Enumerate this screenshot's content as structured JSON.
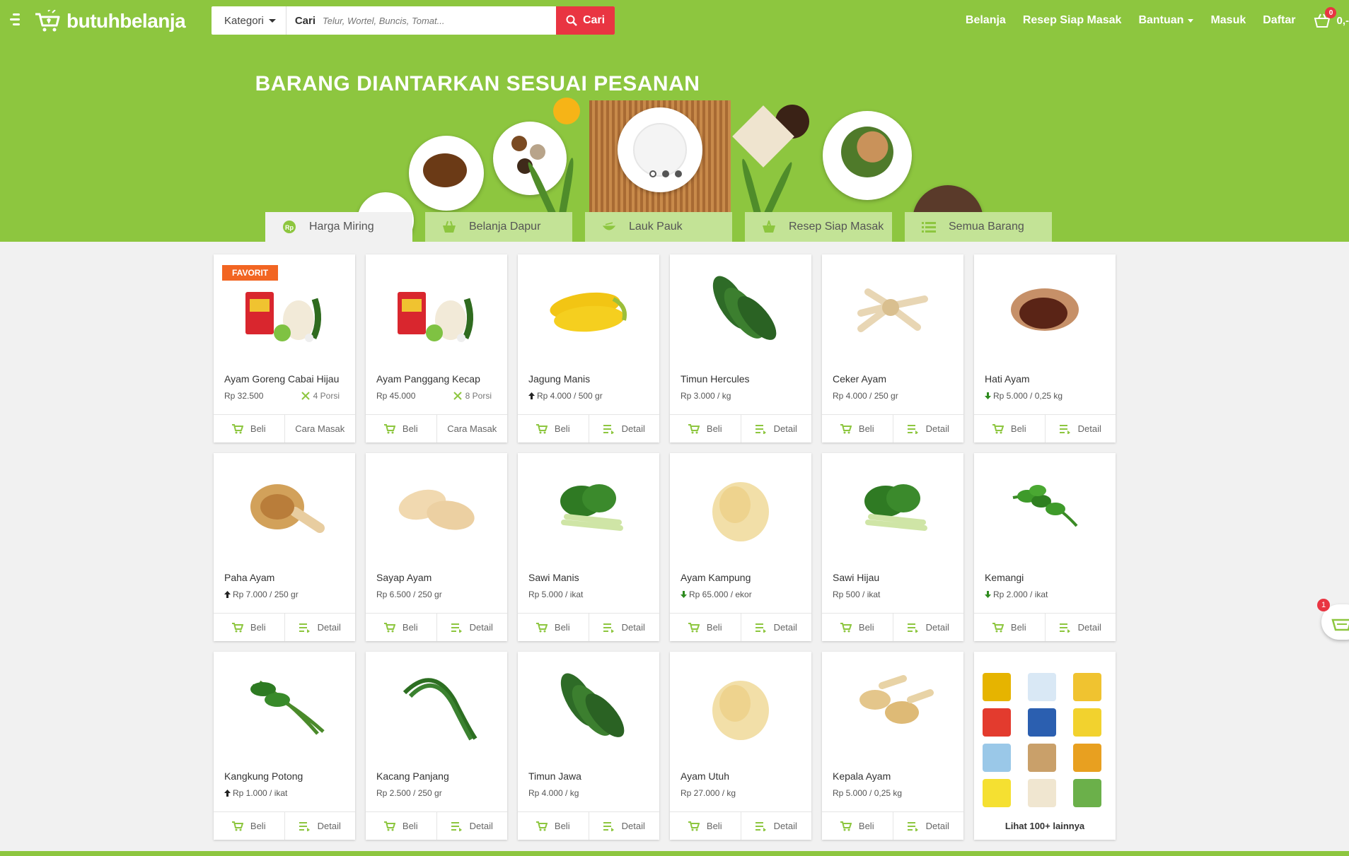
{
  "brand": {
    "name": "butuhbelanja",
    "accent": "#8dc63f",
    "search_red": "#e93542"
  },
  "search": {
    "category_label": "Kategori",
    "label": "Cari",
    "placeholder": "Telur, Wortel, Buncis, Tomat...",
    "button": "Cari"
  },
  "nav": {
    "items": [
      "Belanja",
      "Resep Siap Masak",
      "Bantuan",
      "Masuk",
      "Daftar"
    ],
    "cart_count": "0",
    "cart_total": "0,-"
  },
  "hero": {
    "title": "BARANG DIANTARKAN SESUAI PESANAN",
    "slides": 3,
    "active_slide": 2
  },
  "tabs": [
    {
      "label": "Harga Miring",
      "icon": "rp-coin-icon",
      "active": true
    },
    {
      "label": "Belanja Dapur",
      "icon": "basket-icon",
      "active": false
    },
    {
      "label": "Lauk Pauk",
      "icon": "bowl-icon",
      "active": false
    },
    {
      "label": "Resep Siap Masak",
      "icon": "recipe-basket-icon",
      "active": false
    },
    {
      "label": "Semua Barang",
      "icon": "list-icon",
      "active": false
    }
  ],
  "products": [
    {
      "name": "Ayam Goreng Cabai Hijau",
      "price": "Rp 32.500",
      "portion": "4 Porsi",
      "trend": "none",
      "badge": "FAVORIT",
      "action_left": "Beli",
      "action_right": "Cara Masak",
      "image": "recipe-bundle"
    },
    {
      "name": "Ayam Panggang Kecap",
      "price": "Rp 45.000",
      "portion": "8 Porsi",
      "trend": "none",
      "badge": "",
      "action_left": "Beli",
      "action_right": "Cara Masak",
      "image": "recipe-bundle"
    },
    {
      "name": "Jagung Manis",
      "price": "Rp 4.000 / 500 gr",
      "trend": "up",
      "action_left": "Beli",
      "action_right": "Detail",
      "image": "corn"
    },
    {
      "name": "Timun Hercules",
      "price": "Rp 3.000 / kg",
      "trend": "none",
      "action_left": "Beli",
      "action_right": "Detail",
      "image": "cucumber"
    },
    {
      "name": "Ceker Ayam",
      "price": "Rp 4.000 / 250 gr",
      "trend": "none",
      "action_left": "Beli",
      "action_right": "Detail",
      "image": "chicken-feet"
    },
    {
      "name": "Hati Ayam",
      "price": "Rp 5.000 / 0,25 kg",
      "trend": "down",
      "action_left": "Beli",
      "action_right": "Detail",
      "image": "liver"
    },
    {
      "name": "Paha Ayam",
      "price": "Rp 7.000 / 250 gr",
      "trend": "up",
      "action_left": "Beli",
      "action_right": "Detail",
      "image": "thigh"
    },
    {
      "name": "Sayap Ayam",
      "price": "Rp 6.500 / 250 gr",
      "trend": "none",
      "action_left": "Beli",
      "action_right": "Detail",
      "image": "wings"
    },
    {
      "name": "Sawi Manis",
      "price": "Rp 5.000 / ikat",
      "trend": "none",
      "action_left": "Beli",
      "action_right": "Detail",
      "image": "greens"
    },
    {
      "name": "Ayam Kampung",
      "price": "Rp 65.000 / ekor",
      "trend": "down",
      "action_left": "Beli",
      "action_right": "Detail",
      "image": "whole-chicken"
    },
    {
      "name": "Sawi Hijau",
      "price": "Rp 500 / ikat",
      "trend": "none",
      "action_left": "Beli",
      "action_right": "Detail",
      "image": "greens"
    },
    {
      "name": "Kemangi",
      "price": "Rp 2.000 / ikat",
      "trend": "down",
      "action_left": "Beli",
      "action_right": "Detail",
      "image": "basil"
    },
    {
      "name": "Kangkung Potong",
      "price": "Rp 1.000 / ikat",
      "trend": "up",
      "action_left": "Beli",
      "action_right": "Detail",
      "image": "kangkung"
    },
    {
      "name": "Kacang Panjang",
      "price": "Rp 2.500 / 250 gr",
      "trend": "none",
      "action_left": "Beli",
      "action_right": "Detail",
      "image": "long-beans"
    },
    {
      "name": "Timun Jawa",
      "price": "Rp 4.000 / kg",
      "trend": "none",
      "action_left": "Beli",
      "action_right": "Detail",
      "image": "cucumber"
    },
    {
      "name": "Ayam Utuh",
      "price": "Rp 27.000 / kg",
      "trend": "none",
      "action_left": "Beli",
      "action_right": "Detail",
      "image": "whole-chicken"
    },
    {
      "name": "Kepala Ayam",
      "price": "Rp 5.000 / 0,25 kg",
      "trend": "none",
      "action_left": "Beli",
      "action_right": "Detail",
      "image": "chicken-heads"
    }
  ],
  "more_card": {
    "label": "Lihat 100+ lainnya"
  },
  "floating_basket": {
    "badge": "1"
  }
}
